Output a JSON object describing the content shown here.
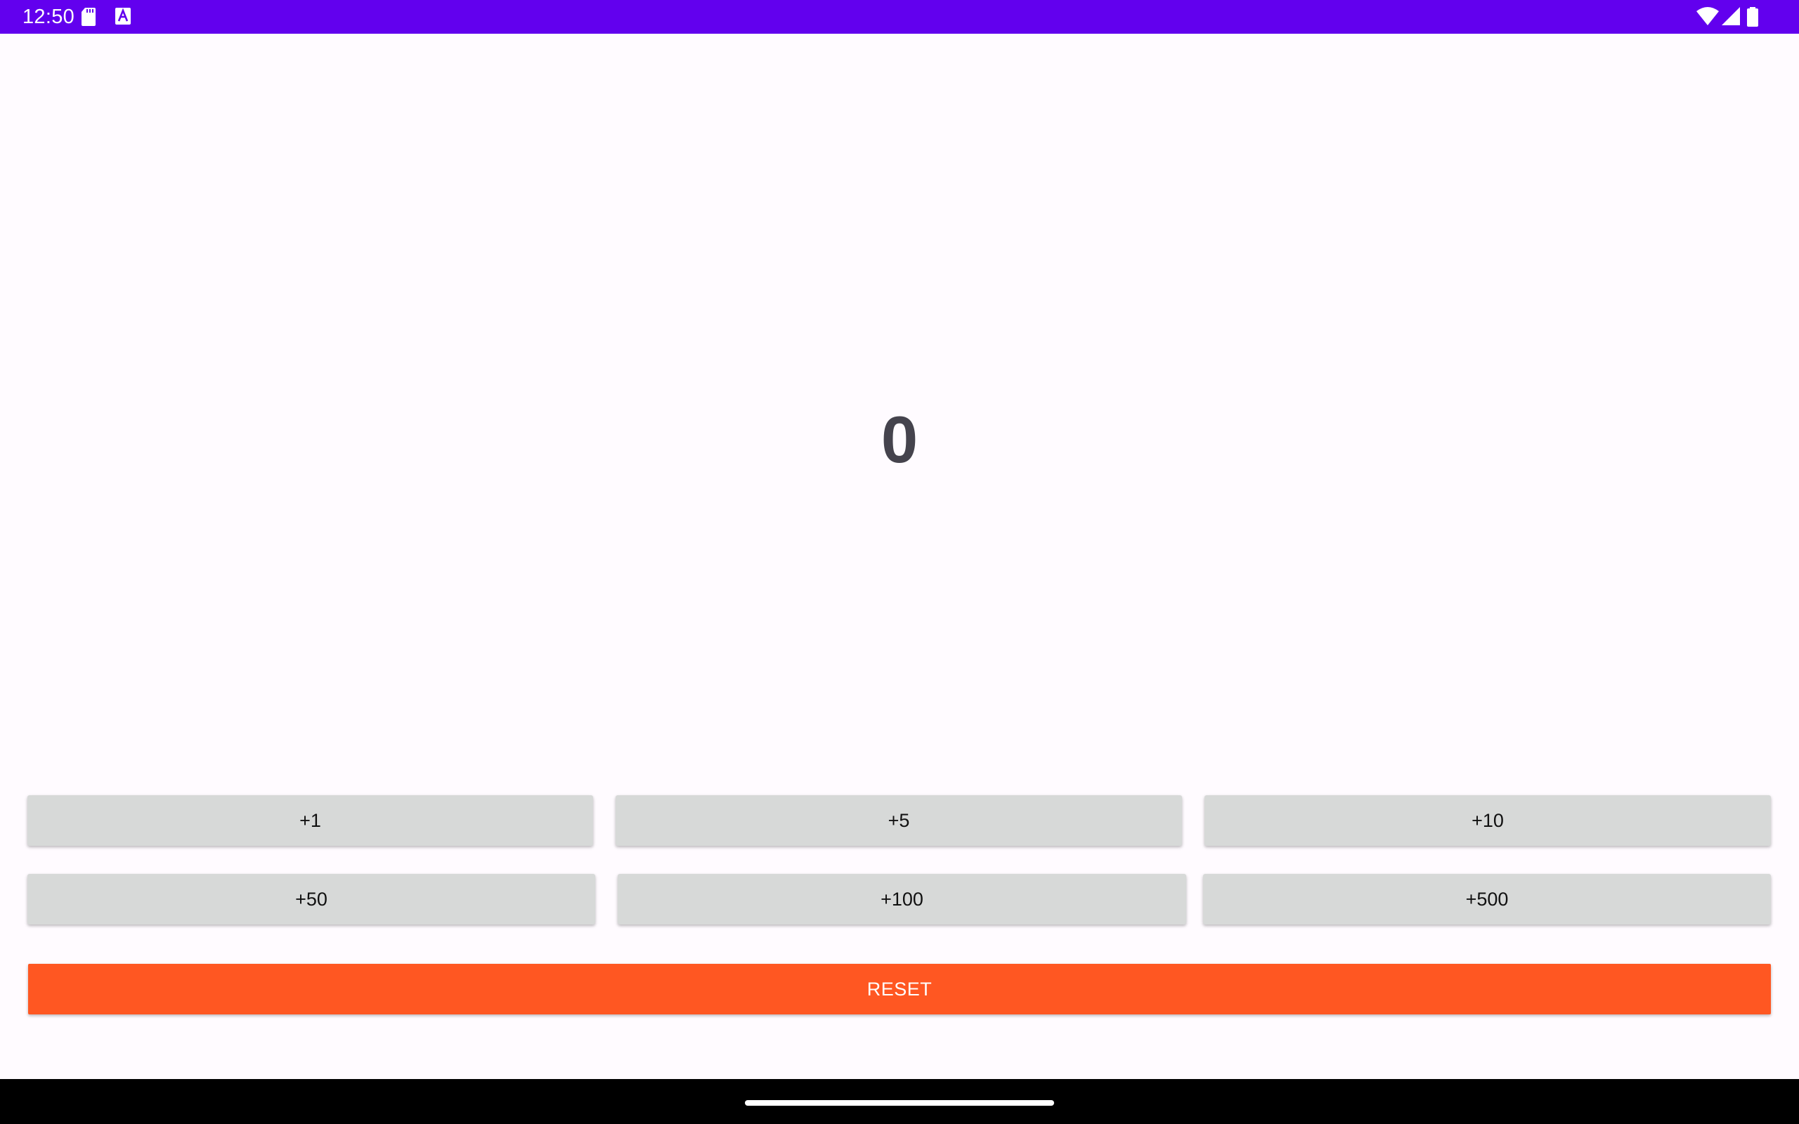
{
  "status_bar": {
    "time": "12:50",
    "color": "#6200ee",
    "icons": [
      "sd-card-icon",
      "a-notification-icon",
      "wifi-icon",
      "signal-icon",
      "battery-icon"
    ]
  },
  "counter": {
    "value": "0"
  },
  "increment_buttons": [
    {
      "label": "+1"
    },
    {
      "label": "+5"
    },
    {
      "label": "+10"
    },
    {
      "label": "+50"
    },
    {
      "label": "+100"
    },
    {
      "label": "+500"
    }
  ],
  "reset_button": {
    "label": "RESET",
    "color": "#ff5722"
  },
  "nav_bar": {
    "handle": "home-handle"
  }
}
